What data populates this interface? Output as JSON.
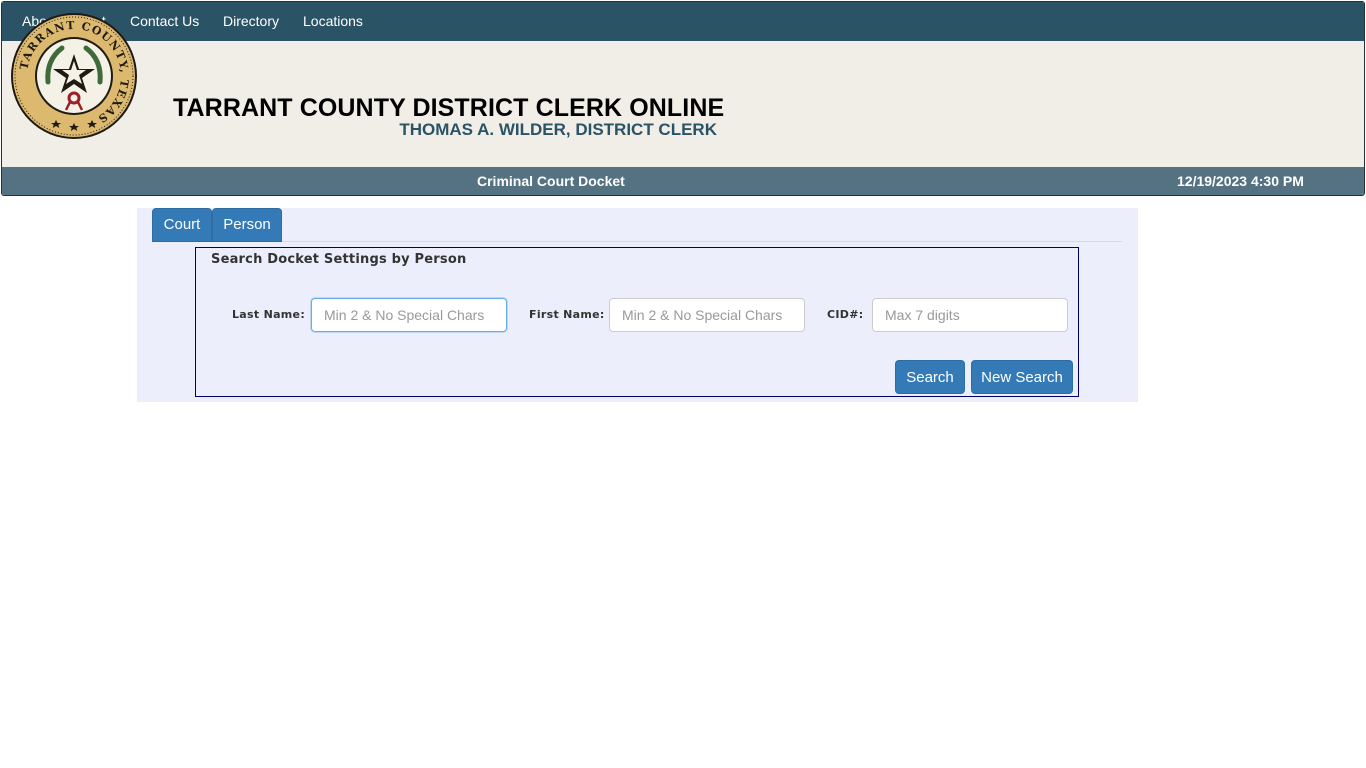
{
  "nav": {
    "items": [
      {
        "label": "About Tarrant"
      },
      {
        "label": "Contact Us"
      },
      {
        "label": "Directory"
      },
      {
        "label": "Locations"
      }
    ]
  },
  "seal": {
    "ring_text": "TARRANT COUNTY, TEXAS",
    "colors": {
      "gold": "#dcb96f",
      "dark": "#1f1a12",
      "green": "#3f6b3a",
      "red": "#9c1f25"
    }
  },
  "header": {
    "title": "TARRANT COUNTY DISTRICT CLERK ONLINE",
    "subtitle": "THOMAS A. WILDER, DISTRICT CLERK"
  },
  "status_bar": {
    "page_name": "Criminal Court Docket",
    "datetime": "12/19/2023 4:30 PM"
  },
  "tabs": [
    {
      "label": "Court"
    },
    {
      "label": "Person"
    }
  ],
  "search_form": {
    "legend": "Search Docket Settings by Person",
    "last_name": {
      "label": "Last Name:",
      "placeholder": "Min 2 & No Special Chars",
      "value": ""
    },
    "first_name": {
      "label": "First Name:",
      "placeholder": "Min 2 & No Special Chars",
      "value": ""
    },
    "cid": {
      "label": "CID#:",
      "placeholder": "Max 7 digits",
      "value": ""
    },
    "search_label": "Search",
    "new_search_label": "New Search"
  },
  "colors": {
    "nav_bg": "#2b5366",
    "banner_bg": "#f1eee8",
    "status_bg": "#557282",
    "accent_blue": "#337ab7",
    "panel_bg": "#eceefb",
    "fieldset_border": "#000066"
  }
}
